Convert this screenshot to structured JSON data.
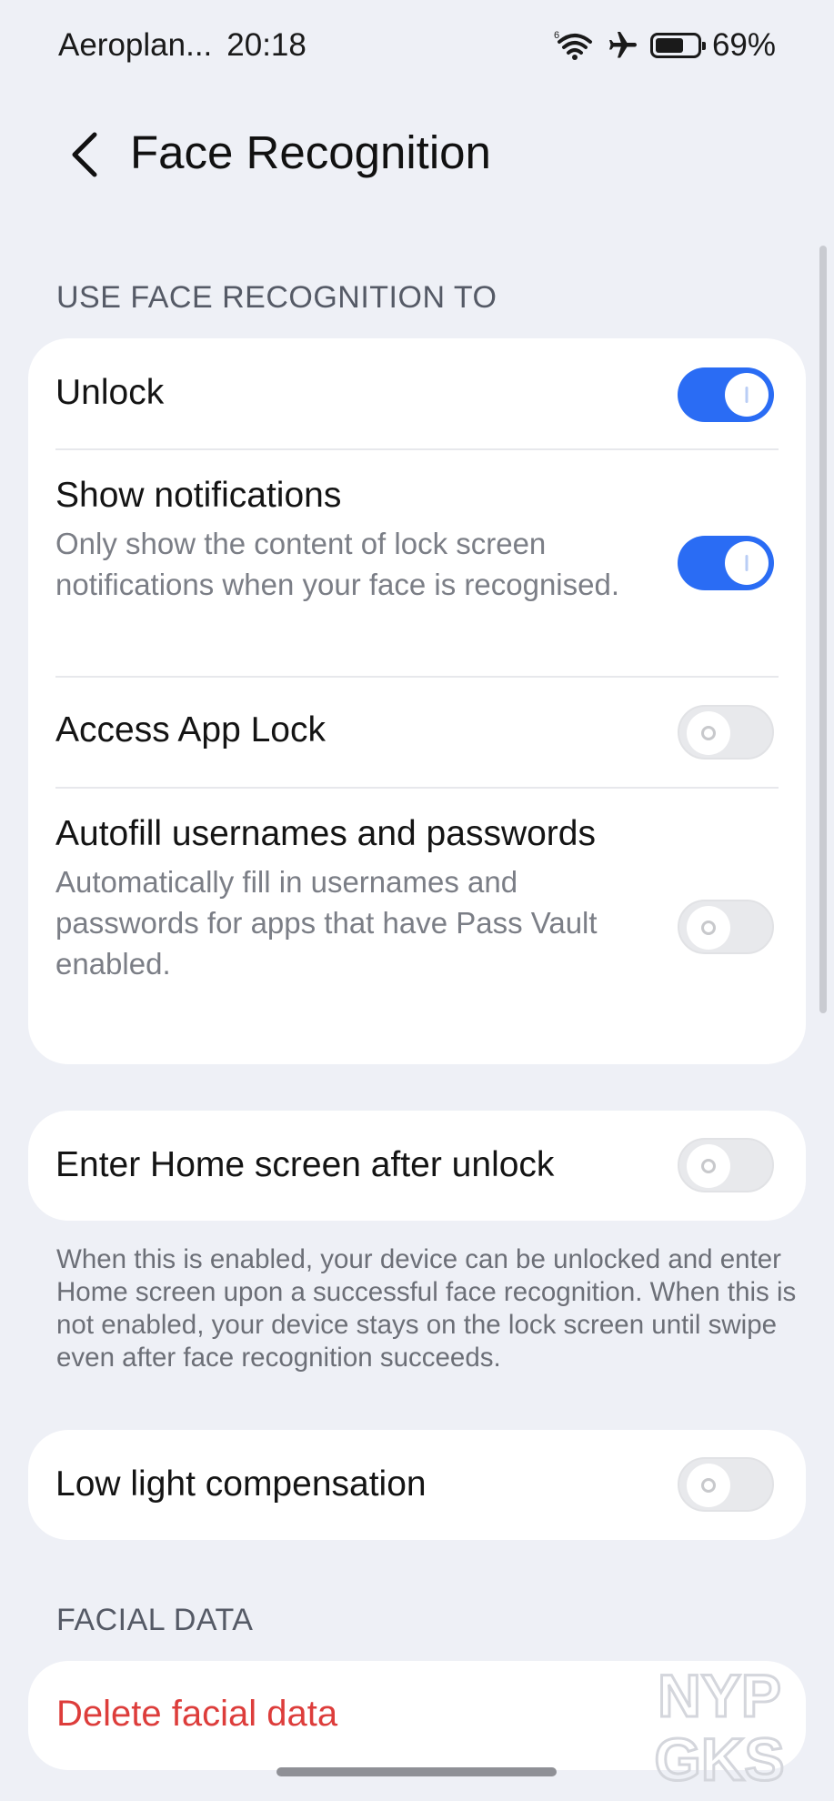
{
  "status_bar": {
    "carrier": "Aeroplan...",
    "time": "20:18",
    "battery": "69%",
    "battery_level": 0.69,
    "icons": [
      "wifi-6-icon",
      "airplane-icon",
      "battery-icon"
    ]
  },
  "header": {
    "title": "Face Recognition",
    "back_icon": "chevron-left-icon"
  },
  "sections": {
    "use_face": {
      "label": "USE FACE RECOGNITION TO",
      "items": [
        {
          "title": "Unlock",
          "description": "",
          "enabled": true
        },
        {
          "title": "Show notifications",
          "description": "Only show the content of lock screen notifications when your face is recognised.",
          "enabled": true
        },
        {
          "title": "Access App Lock",
          "description": "",
          "enabled": false
        },
        {
          "title": "Autofill usernames and passwords",
          "description": "Automatically fill in usernames and passwords for apps that have Pass Vault enabled.",
          "enabled": false
        }
      ]
    },
    "home_screen": {
      "title": "Enter Home screen after unlock",
      "enabled": false,
      "note": "When this is enabled, your device can be unlocked and enter Home screen upon a successful face recognition. When this is not enabled, your device stays on the lock screen until swipe even after face recognition succeeds."
    },
    "low_light": {
      "title": "Low light compensation",
      "enabled": false
    },
    "facial_data": {
      "label": "FACIAL DATA",
      "delete_label": "Delete facial data"
    }
  },
  "watermark": {
    "line1": "NYP",
    "line2": "GKS"
  },
  "colors": {
    "background": "#eef0f6",
    "card": "#ffffff",
    "accent": "#2a6cf4",
    "destructive": "#dd3d3b"
  }
}
